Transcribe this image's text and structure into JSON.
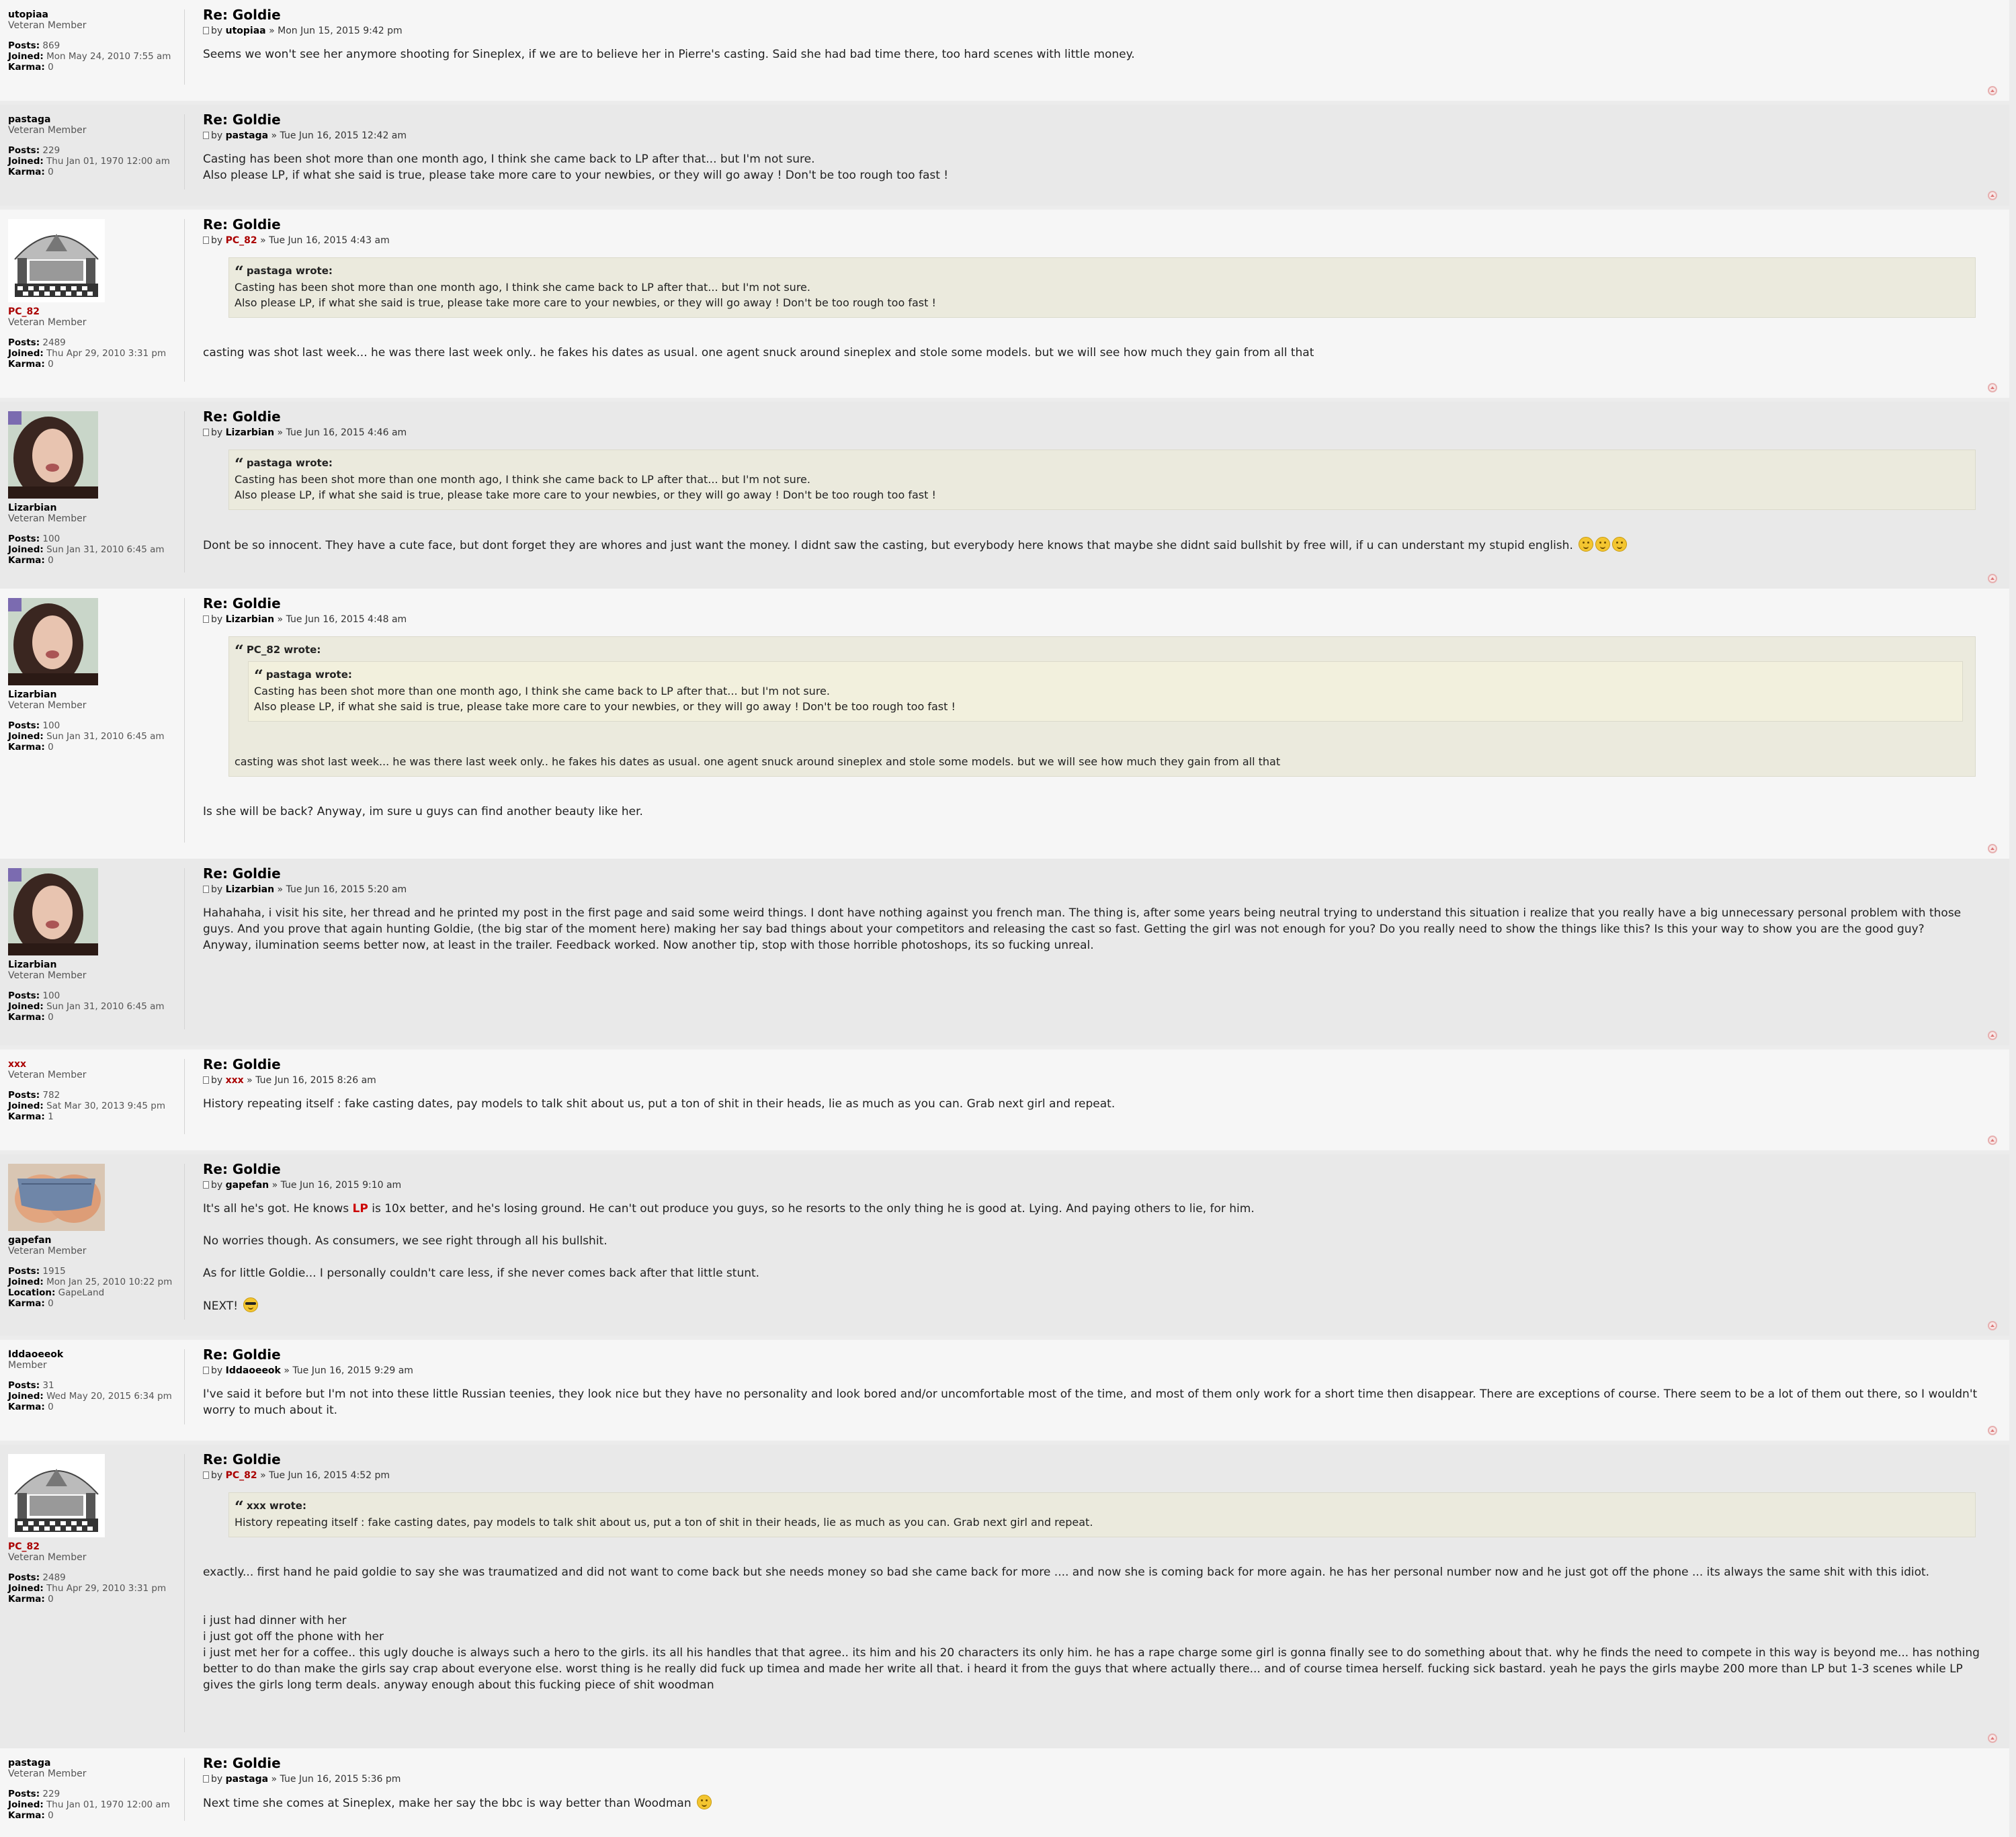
{
  "thread_title": "Re: Goldie",
  "posts": [
    {
      "user": "utopiaa",
      "rank": "Veteran Member",
      "posts_label": "Posts:",
      "posts": "869",
      "joined_label": "Joined:",
      "joined": "Mon May 24, 2010 7:55 am",
      "karma_label": "Karma:",
      "karma": "0",
      "title": "Re: Goldie",
      "by": "by",
      "sep": "»",
      "date": "Mon Jun 15, 2015 9:42 pm",
      "body": [
        "Seems we won't see her anymore shooting for Sineplex, if we are to believe her in Pierre's casting. Said she had bad time there, too hard scenes with little money."
      ]
    },
    {
      "user": "pastaga",
      "rank": "Veteran Member",
      "posts_label": "Posts:",
      "posts": "229",
      "joined_label": "Joined:",
      "joined": "Thu Jan 01, 1970 12:00 am",
      "karma_label": "Karma:",
      "karma": "0",
      "title": "Re: Goldie",
      "by": "by",
      "sep": "»",
      "date": "Tue Jun 16, 2015 12:42 am",
      "body": [
        "Casting has been shot more than one month ago, I think she came back to LP after that... but I'm not sure.",
        "Also please LP, if what she said is true, please take more care to your newbies, or they will go away ! Don't be too rough too fast !"
      ]
    },
    {
      "user": "PC_82",
      "rank": "Veteran Member",
      "posts_label": "Posts:",
      "posts": "2489",
      "joined_label": "Joined:",
      "joined": "Thu Apr 29, 2010 3:31 pm",
      "karma_label": "Karma:",
      "karma": "0",
      "title": "Re: Goldie",
      "by": "by",
      "sep": "»",
      "date": "Tue Jun 16, 2015 4:43 am",
      "quote_head": "pastaga wrote:",
      "quote": [
        "Casting has been shot more than one month ago, I think she came back to LP after that... but I'm not sure.",
        "Also please LP, if what she said is true, please take more care to your newbies, or they will go away ! Don't be too rough too fast !"
      ],
      "body": [
        "casting was shot last week... he was there last week only.. he fakes his dates as usual. one agent snuck around sineplex and stole some models. but we will see how much they gain from all that"
      ]
    },
    {
      "user": "Lizarbian",
      "rank": "Veteran Member",
      "posts_label": "Posts:",
      "posts": "100",
      "joined_label": "Joined:",
      "joined": "Sun Jan 31, 2010 6:45 am",
      "karma_label": "Karma:",
      "karma": "0",
      "title": "Re: Goldie",
      "by": "by",
      "sep": "»",
      "date": "Tue Jun 16, 2015 4:46 am",
      "quote_head": "pastaga wrote:",
      "quote": [
        "Casting has been shot more than one month ago, I think she came back to LP after that... but I'm not sure.",
        "Also please LP, if what she said is true, please take more care to your newbies, or they will go away ! Don't be too rough too fast !"
      ],
      "body": [
        "Dont be so innocent. They have a cute face, but dont forget they are whores and just want the money. I didnt saw the casting, but everybody here knows that maybe she didnt said bullshit by free will, if u can understant my stupid english."
      ]
    },
    {
      "user": "Lizarbian",
      "rank": "Veteran Member",
      "posts_label": "Posts:",
      "posts": "100",
      "joined_label": "Joined:",
      "joined": "Sun Jan 31, 2010 6:45 am",
      "karma_label": "Karma:",
      "karma": "0",
      "title": "Re: Goldie",
      "by": "by",
      "sep": "»",
      "date": "Tue Jun 16, 2015 4:48 am",
      "quote_head": "PC_82 wrote:",
      "inner_quote_head": "pastaga wrote:",
      "inner_quote": [
        "Casting has been shot more than one month ago, I think she came back to LP after that... but I'm not sure.",
        "Also please LP, if what she said is true, please take more care to your newbies, or they will go away ! Don't be too rough too fast !"
      ],
      "quote": [
        "casting was shot last week... he was there last week only.. he fakes his dates as usual. one agent snuck around sineplex and stole some models. but we will see how much they gain from all that"
      ],
      "body": [
        "Is she will be back? Anyway, im sure u guys can find another beauty like her."
      ]
    },
    {
      "user": "Lizarbian",
      "rank": "Veteran Member",
      "posts_label": "Posts:",
      "posts": "100",
      "joined_label": "Joined:",
      "joined": "Sun Jan 31, 2010 6:45 am",
      "karma_label": "Karma:",
      "karma": "0",
      "title": "Re: Goldie",
      "by": "by",
      "sep": "»",
      "date": "Tue Jun 16, 2015 5:20 am",
      "body": [
        "Hahahaha, i visit his site, her thread and he printed my post in the first page and said some weird things. I dont have nothing against you french man. The thing is, after some years being neutral trying to understand this situation i realize that you really have a big unnecessary personal problem with those guys. And you prove that again hunting Goldie, (the big star of the moment here) making her say bad things about your competitors and releasing the cast so fast. Getting the girl was not enough for you? Do you really need to show the things like this? Is this your way to show you are the good guy?",
        "Anyway, ilumination seems better now, at least in the trailer. Feedback worked. Now another tip, stop with those horrible photoshops, its so fucking unreal."
      ]
    },
    {
      "user": "xxx",
      "rank": "Veteran Member",
      "posts_label": "Posts:",
      "posts": "782",
      "joined_label": "Joined:",
      "joined": "Sat Mar 30, 2013 9:45 pm",
      "karma_label": "Karma:",
      "karma": "1",
      "title": "Re: Goldie",
      "by": "by",
      "sep": "»",
      "date": "Tue Jun 16, 2015 8:26 am",
      "body": [
        "History repeating itself : fake casting dates, pay models to talk shit about us, put a ton of shit in their heads, lie as much as you can. Grab next girl and repeat."
      ]
    },
    {
      "user": "gapefan",
      "rank": "Veteran Member",
      "posts_label": "Posts:",
      "posts": "1915",
      "joined_label": "Joined:",
      "joined": "Mon Jan 25, 2010 10:22 pm",
      "location_label": "Location:",
      "location": "GapeLand",
      "karma_label": "Karma:",
      "karma": "0",
      "title": "Re: Goldie",
      "by": "by",
      "sep": "»",
      "date": "Tue Jun 16, 2015 9:10 am",
      "body_pre": "It's all he's got. He knows ",
      "body_lp": "LP",
      "body_post": " is 10x better, and he's losing ground. He can't out produce you guys, so he resorts to the only thing he is good at. Lying. And paying others to lie, for him.",
      "body2": "No worries though. As consumers, we see right through all his bullshit.",
      "body3": "As for little Goldie... I personally couldn't care less, if she never comes back after that little stunt.",
      "body4": "NEXT!"
    },
    {
      "user": "Iddaoeeok",
      "rank": "Member",
      "posts_label": "Posts:",
      "posts": "31",
      "joined_label": "Joined:",
      "joined": "Wed May 20, 2015 6:34 pm",
      "karma_label": "Karma:",
      "karma": "0",
      "title": "Re: Goldie",
      "by": "by",
      "sep": "»",
      "date": "Tue Jun 16, 2015 9:29 am",
      "body": [
        "I've said it before but I'm not into these little Russian teenies, they look nice but they have no personality and look bored and/or uncomfortable most of the time, and most of them only work for a short time then disappear. There are exceptions of course. There seem to be a lot of them out there, so I wouldn't worry to much about it."
      ]
    },
    {
      "user": "PC_82",
      "rank": "Veteran Member",
      "posts_label": "Posts:",
      "posts": "2489",
      "joined_label": "Joined:",
      "joined": "Thu Apr 29, 2010 3:31 pm",
      "karma_label": "Karma:",
      "karma": "0",
      "title": "Re: Goldie",
      "by": "by",
      "sep": "»",
      "date": "Tue Jun 16, 2015 4:52 pm",
      "quote_head": "xxx wrote:",
      "quote": [
        "History repeating itself : fake casting dates, pay models to talk shit about us, put a ton of shit in their heads, lie as much as you can. Grab next girl and repeat."
      ],
      "body": [
        "exactly... first hand he paid goldie to say she was traumatized and did not want to come back but she needs money so bad she came back for more .... and now she is coming back for more again. he has her personal number now and he just got off the phone ... its always the same shit with this idiot."
      ],
      "body_b": [
        "i just had dinner with her",
        "i just got off the phone with her",
        "i just met her for a coffee.. this ugly douche is always such a hero to the girls. its all his handles that that agree.. its him and his 20 characters its only him. he has a rape charge some girl is gonna finally see to do something about that. why he finds the need to compete in this way is beyond me... has nothing better to do than make the girls say crap about everyone else. worst thing is he really did fuck up timea and made her write all that. i heard it from the guys that where actually there... and of course timea herself. fucking sick bastard. yeah he pays the girls maybe 200 more than LP but 1-3 scenes while LP gives the girls long term deals. anyway enough about this fucking piece of shit woodman"
      ]
    },
    {
      "user": "pastaga",
      "rank": "Veteran Member",
      "posts_label": "Posts:",
      "posts": "229",
      "joined_label": "Joined:",
      "joined": "Thu Jan 01, 1970 12:00 am",
      "karma_label": "Karma:",
      "karma": "0",
      "title": "Re: Goldie",
      "by": "by",
      "sep": "»",
      "date": "Tue Jun 16, 2015 5:36 pm",
      "body": [
        "Next time she comes at Sineplex, make her say the bbc is way better than Woodman"
      ]
    }
  ],
  "icons": {
    "doc": "doc-icon",
    "top": "back-to-top-icon",
    "smiley": "smiley-icon",
    "cool": "cool-smiley-icon"
  },
  "colors": {
    "alt1": "#f6f6f6",
    "alt2": "#e9e9e9",
    "quote_bg": "#ebeadd",
    "mod_name": "#aa0000"
  }
}
